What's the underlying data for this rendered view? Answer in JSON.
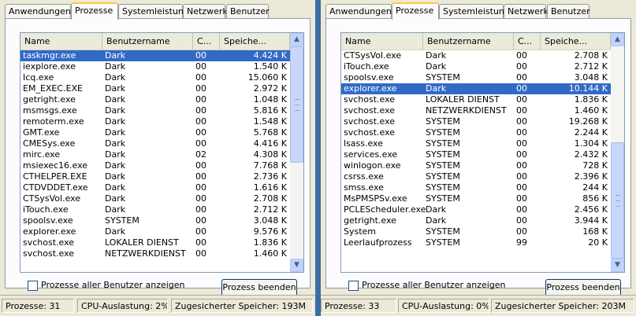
{
  "left": {
    "tabs": [
      "Anwendungen",
      "Prozesse",
      "Systemleistung",
      "Netzwerk",
      "Benutzer"
    ],
    "active_tab": "Prozesse",
    "columns": [
      "Name",
      "Benutzername",
      "C...",
      "Speiche..."
    ],
    "rows": [
      {
        "name": "taskmgr.exe",
        "user": "Dark",
        "cpu": "00",
        "mem": "4.424 K",
        "selected": true
      },
      {
        "name": "iexplore.exe",
        "user": "Dark",
        "cpu": "00",
        "mem": "1.540 K"
      },
      {
        "name": "Icq.exe",
        "user": "Dark",
        "cpu": "00",
        "mem": "15.060 K"
      },
      {
        "name": "EM_EXEC.EXE",
        "user": "Dark",
        "cpu": "00",
        "mem": "2.972 K"
      },
      {
        "name": "getright.exe",
        "user": "Dark",
        "cpu": "00",
        "mem": "1.048 K"
      },
      {
        "name": "msmsgs.exe",
        "user": "Dark",
        "cpu": "00",
        "mem": "5.816 K"
      },
      {
        "name": "remoterm.exe",
        "user": "Dark",
        "cpu": "00",
        "mem": "1.548 K"
      },
      {
        "name": "GMT.exe",
        "user": "Dark",
        "cpu": "00",
        "mem": "5.768 K"
      },
      {
        "name": "CMESys.exe",
        "user": "Dark",
        "cpu": "00",
        "mem": "4.416 K"
      },
      {
        "name": "mirc.exe",
        "user": "Dark",
        "cpu": "02",
        "mem": "4.308 K"
      },
      {
        "name": "msiexec16.exe",
        "user": "Dark",
        "cpu": "00",
        "mem": "7.768 K"
      },
      {
        "name": "CTHELPER.EXE",
        "user": "Dark",
        "cpu": "00",
        "mem": "2.736 K"
      },
      {
        "name": "CTDVDDET.exe",
        "user": "Dark",
        "cpu": "00",
        "mem": "1.616 K"
      },
      {
        "name": "CTSysVol.exe",
        "user": "Dark",
        "cpu": "00",
        "mem": "2.708 K"
      },
      {
        "name": "iTouch.exe",
        "user": "Dark",
        "cpu": "00",
        "mem": "2.712 K"
      },
      {
        "name": "spoolsv.exe",
        "user": "SYSTEM",
        "cpu": "00",
        "mem": "3.048 K"
      },
      {
        "name": "explorer.exe",
        "user": "Dark",
        "cpu": "00",
        "mem": "9.576 K"
      },
      {
        "name": "svchost.exe",
        "user": "LOKALER DIENST",
        "cpu": "00",
        "mem": "1.836 K"
      },
      {
        "name": "svchost.exe",
        "user": "NETZWERKDIENST",
        "cpu": "00",
        "mem": "1.460 K"
      }
    ],
    "scroll_fraction": 0.0,
    "checkbox_label": "Prozesse aller Benutzer anzeigen",
    "checkbox_checked": false,
    "end_button": "Prozess beenden",
    "status": {
      "processes": "Prozesse: 31",
      "cpu": "CPU-Auslastung: 2%",
      "commit": "Zugesicherter Speicher: 193M"
    }
  },
  "right": {
    "tabs": [
      "Anwendungen",
      "Prozesse",
      "Systemleistung",
      "Netzwerk",
      "Benutzer"
    ],
    "active_tab": "Prozesse",
    "columns": [
      "Name",
      "Benutzername",
      "C...",
      "Speiche..."
    ],
    "rows": [
      {
        "name": "CTSysVol.exe",
        "user": "Dark",
        "cpu": "00",
        "mem": "2.708 K"
      },
      {
        "name": "iTouch.exe",
        "user": "Dark",
        "cpu": "00",
        "mem": "2.712 K"
      },
      {
        "name": "spoolsv.exe",
        "user": "SYSTEM",
        "cpu": "00",
        "mem": "3.048 K"
      },
      {
        "name": "explorer.exe",
        "user": "Dark",
        "cpu": "00",
        "mem": "10.144 K",
        "selected": true
      },
      {
        "name": "svchost.exe",
        "user": "LOKALER DIENST",
        "cpu": "00",
        "mem": "1.836 K"
      },
      {
        "name": "svchost.exe",
        "user": "NETZWERKDIENST",
        "cpu": "00",
        "mem": "1.460 K"
      },
      {
        "name": "svchost.exe",
        "user": "SYSTEM",
        "cpu": "00",
        "mem": "19.268 K"
      },
      {
        "name": "svchost.exe",
        "user": "SYSTEM",
        "cpu": "00",
        "mem": "2.244 K"
      },
      {
        "name": "lsass.exe",
        "user": "SYSTEM",
        "cpu": "00",
        "mem": "1.304 K"
      },
      {
        "name": "services.exe",
        "user": "SYSTEM",
        "cpu": "00",
        "mem": "2.432 K"
      },
      {
        "name": "winlogon.exe",
        "user": "SYSTEM",
        "cpu": "00",
        "mem": "728 K"
      },
      {
        "name": "csrss.exe",
        "user": "SYSTEM",
        "cpu": "00",
        "mem": "2.396 K"
      },
      {
        "name": "smss.exe",
        "user": "SYSTEM",
        "cpu": "00",
        "mem": "244 K"
      },
      {
        "name": "MsPMSPSv.exe",
        "user": "SYSTEM",
        "cpu": "00",
        "mem": "856 K"
      },
      {
        "name": "PCLEScheduler.exe",
        "user": "Dark",
        "cpu": "00",
        "mem": "2.456 K"
      },
      {
        "name": "getright.exe",
        "user": "Dark",
        "cpu": "00",
        "mem": "3.944 K"
      },
      {
        "name": "System",
        "user": "SYSTEM",
        "cpu": "00",
        "mem": "168 K"
      },
      {
        "name": "Leerlaufprozess",
        "user": "SYSTEM",
        "cpu": "99",
        "mem": "20 K"
      }
    ],
    "scroll_fraction": 1.0,
    "checkbox_label": "Prozesse aller Benutzer anzeigen",
    "checkbox_checked": false,
    "end_button": "Prozess beenden",
    "status": {
      "processes": "Prozesse: 33",
      "cpu": "CPU-Auslastung: 0%",
      "commit": "Zugesicherter Speicher: 203M"
    }
  }
}
